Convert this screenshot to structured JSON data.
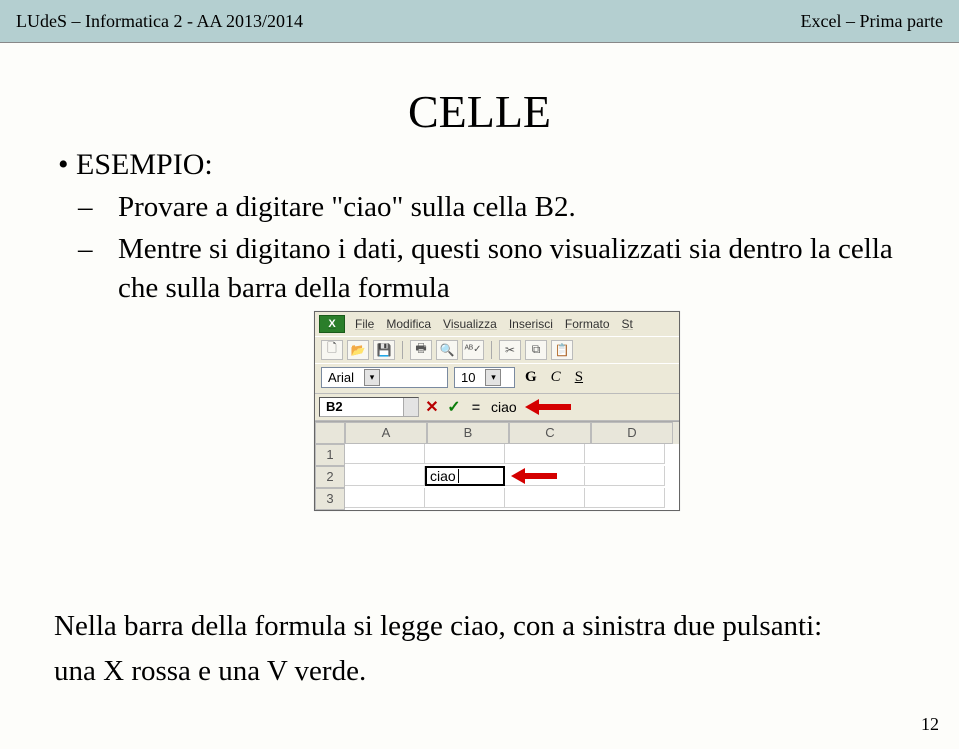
{
  "header": {
    "left": "LUdeS – Informatica 2 - AA 2013/2014",
    "right": "Excel – Prima parte"
  },
  "title": "CELLE",
  "bullets": {
    "l1": "ESEMPIO:",
    "l2a": "Provare a digitare \"ciao\" sulla cella B2.",
    "l2b": "Mentre si digitano i dati, questi sono visualizzati sia dentro la cella che sulla barra della formula"
  },
  "excel": {
    "menu": {
      "file": "File",
      "modifica": "Modifica",
      "visualizza": "Visualizza",
      "inserisci": "Inserisci",
      "formato": "Formato",
      "st": "St"
    },
    "font": {
      "name": "Arial",
      "size": "10",
      "b": "G",
      "i": "C",
      "u": "S"
    },
    "namebox": "B2",
    "formula_text": "ciao",
    "cols": {
      "a": "A",
      "b": "B",
      "c": "C",
      "d": "D"
    },
    "rows": {
      "r1": "1",
      "r2": "2",
      "r3": "3"
    },
    "cell_b2": "ciao"
  },
  "footer": {
    "line1": "Nella barra della formula si legge ciao, con a sinistra due pulsanti:",
    "line2": "una X rossa e una V verde."
  },
  "pagenum": "12"
}
